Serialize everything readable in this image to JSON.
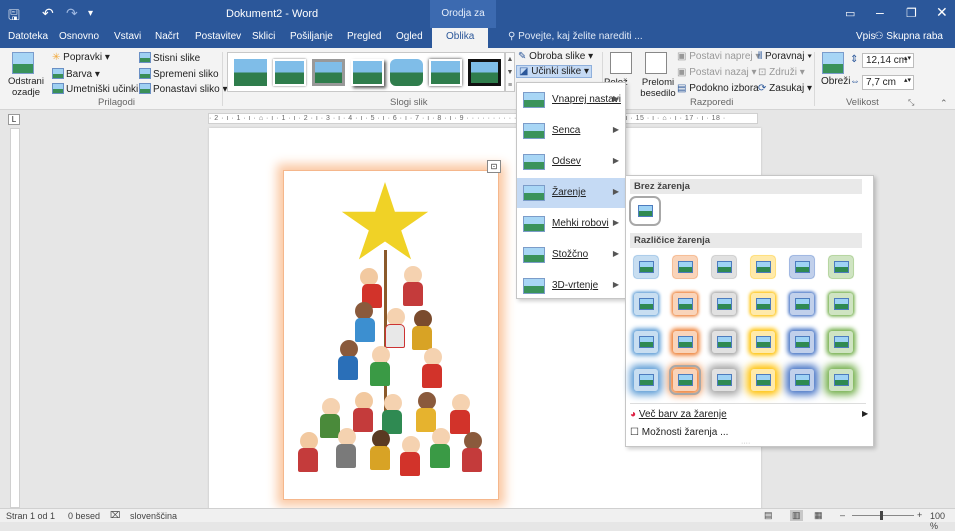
{
  "titlebar": {
    "doc_title": "Dokument2 - Word",
    "context_title": "Orodja za slike"
  },
  "tabs": [
    "Datoteka",
    "Osnovno",
    "Vstavi",
    "Načrt",
    "Postavitev",
    "Sklici",
    "Pošiljanje",
    "Pregled",
    "Ogled",
    "Oblika"
  ],
  "tellme": "Povejte, kaj želite narediti ...",
  "signin": "Vpis",
  "share": "Skupna raba",
  "ribbon": {
    "remove_bg": "Odstrani ozadje",
    "corrections": "Popravki",
    "color": "Barva",
    "artistic": "Umetniški učinki",
    "compress": "Stisni slike",
    "change": "Spremeni sliko",
    "reset": "Ponastavi sliko",
    "group_adjust": "Prilagodi",
    "group_styles": "Slogi slik",
    "border": "Obroba slike",
    "effects": "Učinki slike",
    "layout": "Polož",
    "position": "Položaj",
    "wrap": "Prelomi besedilo",
    "bring_forward": "Postavi naprej",
    "send_backward": "Postavi nazaj",
    "selection_pane": "Podokno izbora",
    "align": "Poravnaj",
    "group": "Združi",
    "rotate": "Zasukaj",
    "group_arrange": "Razporedi",
    "crop": "Obreži",
    "height": "12,14 cm",
    "width": "7,7 cm",
    "group_size": "Velikost"
  },
  "ruler_text": "· 2 · ı · 1 · ı · ⌂ · ı · 1 · ı · 2 · ı · 3 · ı · 4 · ı · 5 · ı · 6 · ı · 7 · ı · 8 · ı · 9 · · · · · · · · · · · · · · · · · · · · · · · · · · · 14 · ı · 15 · ı · ⌂ · ı · 17 · ı · 18 ·",
  "effects_menu": [
    {
      "label": "Vnaprej nastavi"
    },
    {
      "label": "Senca"
    },
    {
      "label": "Odsev"
    },
    {
      "label": "Žarenje"
    },
    {
      "label": "Mehki robovi"
    },
    {
      "label": "Stožčno"
    },
    {
      "label": "3D-vrtenje"
    }
  ],
  "glow_menu": {
    "no_glow": "Brez žarenja",
    "variants": "Različice žarenja",
    "more_colors": "Več barv za žarenje",
    "options": "Možnosti žarenja ..."
  },
  "glow_colors": [
    "#5b9bd5",
    "#ed7d31",
    "#a5a5a5",
    "#ffc000",
    "#4472c4",
    "#70ad47"
  ],
  "statusbar": {
    "page": "Stran 1 od 1",
    "words": "0 besed",
    "language": "slovenščina",
    "zoom": "100 %"
  }
}
